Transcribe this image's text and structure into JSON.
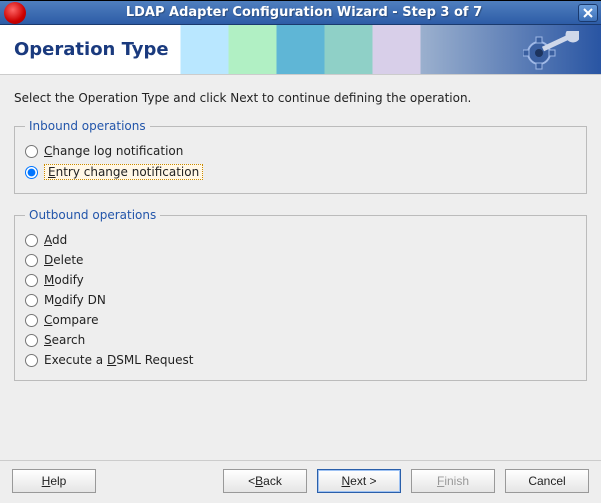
{
  "window": {
    "title": "LDAP Adapter Configuration Wizard - Step 3 of 7"
  },
  "banner": {
    "heading": "Operation Type"
  },
  "instruction": "Select the Operation Type and click Next to continue defining the operation.",
  "inbound": {
    "legend": "Inbound operations",
    "options": [
      {
        "pre": "",
        "accel": "C",
        "post": "hange log notification",
        "selected": false
      },
      {
        "pre": "",
        "accel": "E",
        "post": "ntry change notification",
        "selected": true
      }
    ]
  },
  "outbound": {
    "legend": "Outbound operations",
    "options": [
      {
        "pre": "",
        "accel": "A",
        "post": "dd",
        "selected": false
      },
      {
        "pre": "",
        "accel": "D",
        "post": "elete",
        "selected": false
      },
      {
        "pre": "",
        "accel": "M",
        "post": "odify",
        "selected": false
      },
      {
        "pre": "M",
        "accel": "o",
        "post": "dify DN",
        "selected": false
      },
      {
        "pre": "",
        "accel": "C",
        "post": "ompare",
        "selected": false
      },
      {
        "pre": "",
        "accel": "S",
        "post": "earch",
        "selected": false
      },
      {
        "pre": "Execute a ",
        "accel": "D",
        "post": "SML Request",
        "selected": false
      }
    ]
  },
  "buttons": {
    "help": {
      "pre": "",
      "accel": "H",
      "post": "elp"
    },
    "back": {
      "pre": "< ",
      "accel": "B",
      "post": "ack"
    },
    "next": {
      "pre": "",
      "accel": "N",
      "post": "ext >"
    },
    "finish": {
      "pre": "",
      "accel": "F",
      "post": "inish"
    },
    "cancel": {
      "pre": "Cancel",
      "accel": "",
      "post": ""
    }
  }
}
